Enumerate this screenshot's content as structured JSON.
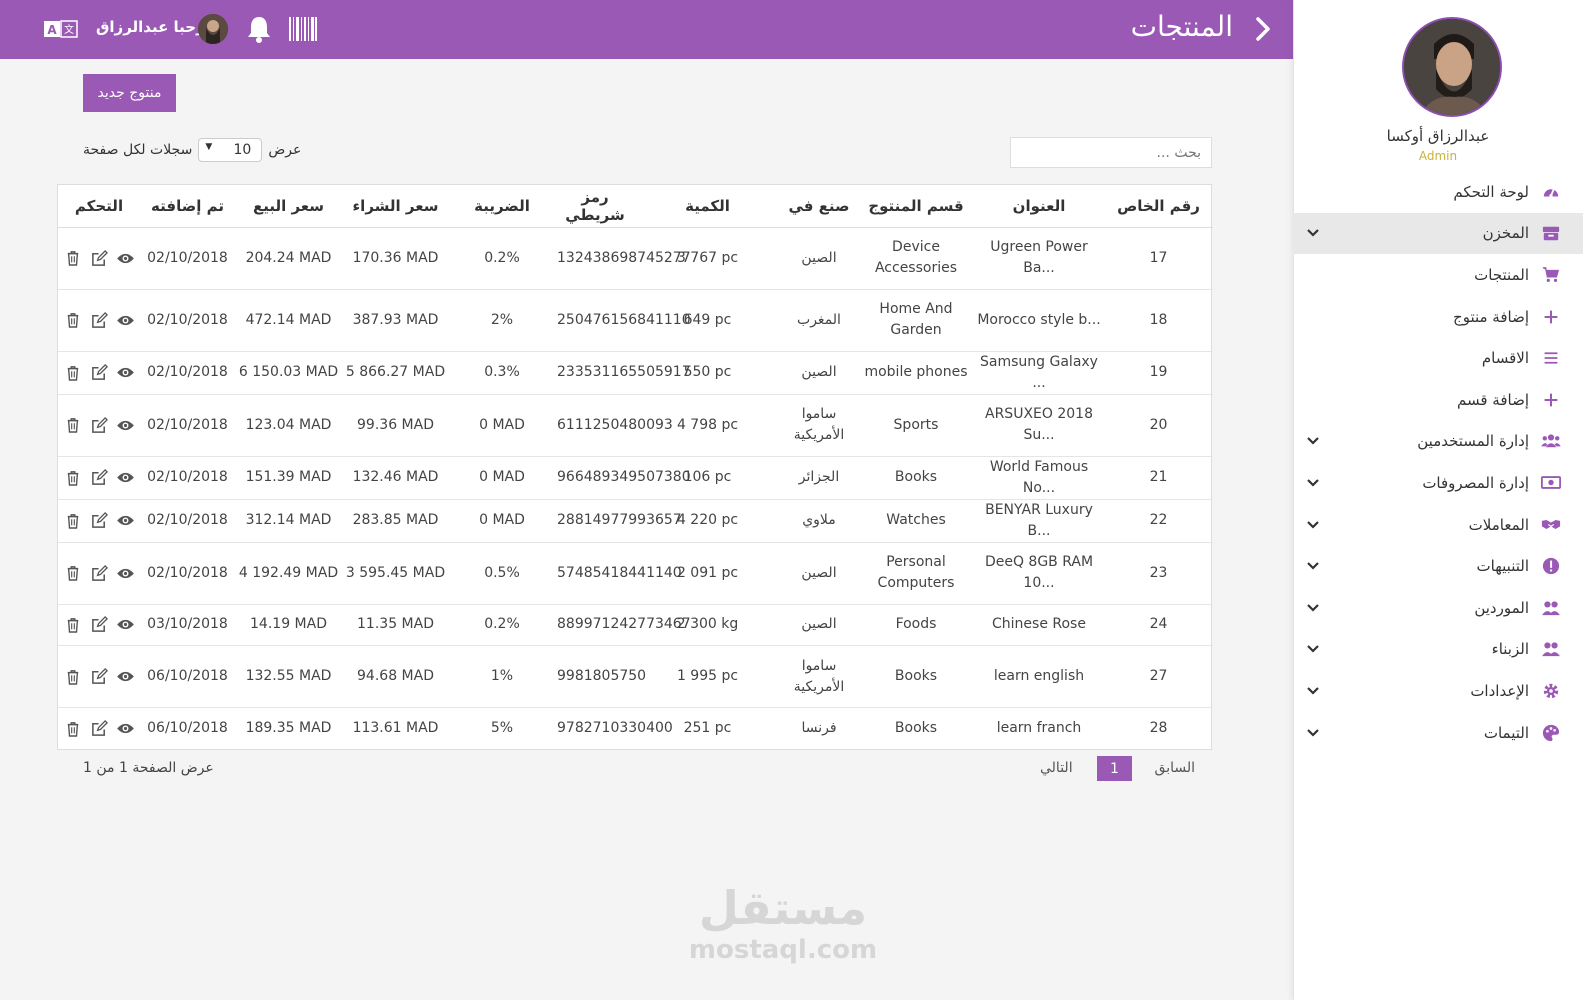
{
  "header": {
    "title": "المنتجات",
    "greeting": "مرحبا عبدالرزاق",
    "lang_label": "A文"
  },
  "sidebar": {
    "user_name": "عبدالرزاق أوكسا",
    "user_role": "Admin",
    "items": [
      {
        "label": "لوحة التحكم",
        "icon": "dashboard-icon"
      },
      {
        "label": "المخزن",
        "icon": "warehouse-icon"
      },
      {
        "label": "المنتجات",
        "icon": "cart-icon"
      },
      {
        "label": "إضافة منتوج",
        "icon": "plus-icon"
      },
      {
        "label": "الاقسام",
        "icon": "list-icon"
      },
      {
        "label": "إضافة قسم",
        "icon": "plus-icon"
      },
      {
        "label": "إدارة المستخدمين",
        "icon": "users-icon"
      },
      {
        "label": "إدارة المصروفات",
        "icon": "money-icon"
      },
      {
        "label": "المعاملات",
        "icon": "handshake-icon"
      },
      {
        "label": "التنبيهات",
        "icon": "alert-icon"
      },
      {
        "label": "الموردين",
        "icon": "suppliers-icon"
      },
      {
        "label": "الزبناء",
        "icon": "customers-icon"
      },
      {
        "label": "الإعدادات",
        "icon": "gear-icon"
      },
      {
        "label": "التيمات",
        "icon": "palette-icon"
      }
    ]
  },
  "toolbar": {
    "new_button": "منتوج جديد",
    "show_label": "عرض",
    "page_length": "10",
    "per_page_label": "سجلات لكل صفحة",
    "search_placeholder": "بحث ..."
  },
  "table": {
    "columns": [
      "رقم الخاص",
      "العنوان",
      "قسم المنتوج",
      "صنع في",
      "الكمية",
      "رمز شريطي",
      "الضريبة",
      "سعر الشراء",
      "سعر البيع",
      "تم إضافته",
      "التحكم"
    ],
    "rows": [
      {
        "id": "17",
        "title": "Ugreen Power Ba...",
        "category": "Device Accessories",
        "made_in": "الصين",
        "qty": "3 767 pc",
        "barcode": "132438698745277",
        "tax": "0.2%",
        "buy": "170.36 MAD",
        "sell": "204.24 MAD",
        "date": "02/10/2018"
      },
      {
        "id": "18",
        "title": "Morocco style b...",
        "category": "Home And Garden",
        "made_in": "المغرب",
        "qty": "649 pc",
        "barcode": "250476156841110",
        "tax": "2%",
        "buy": "387.93 MAD",
        "sell": "472.14 MAD",
        "date": "02/10/2018"
      },
      {
        "id": "19",
        "title": "Samsung Galaxy ...",
        "category": "mobile phones",
        "made_in": "الصين",
        "qty": "550 pc",
        "barcode": "233531165505917",
        "tax": "0.3%",
        "buy": "5 866.27 MAD",
        "sell": "6 150.03 MAD",
        "date": "02/10/2018"
      },
      {
        "id": "20",
        "title": "ARSUXEO 2018 Su...",
        "category": "Sports",
        "made_in": "ساموا الأمريكية",
        "qty": "4 798 pc",
        "barcode": "6111250480093",
        "tax": "0 MAD",
        "buy": "99.36 MAD",
        "sell": "123.04 MAD",
        "date": "02/10/2018"
      },
      {
        "id": "21",
        "title": "World Famous No...",
        "category": "Books",
        "made_in": "الجزائر",
        "qty": "106 pc",
        "barcode": "966489349507380",
        "tax": "0 MAD",
        "buy": "132.46 MAD",
        "sell": "151.39 MAD",
        "date": "02/10/2018"
      },
      {
        "id": "22",
        "title": "BENYAR Luxury B...",
        "category": "Watches",
        "made_in": "ملاوي",
        "qty": "4 220 pc",
        "barcode": "28814977993657",
        "tax": "0 MAD",
        "buy": "283.85 MAD",
        "sell": "312.14 MAD",
        "date": "02/10/2018"
      },
      {
        "id": "23",
        "title": "DeeQ 8GB RAM 10...",
        "category": "Personal Computers",
        "made_in": "الصين",
        "qty": "2 091 pc",
        "barcode": "57485418441140",
        "tax": "0.5%",
        "buy": "3 595.45 MAD",
        "sell": "4 192.49 MAD",
        "date": "02/10/2018"
      },
      {
        "id": "24",
        "title": "Chinese Rose",
        "category": "Foods",
        "made_in": "الصين",
        "qty": "2 300 kg",
        "barcode": "889971242773467",
        "tax": "0.2%",
        "buy": "11.35 MAD",
        "sell": "14.19 MAD",
        "date": "03/10/2018"
      },
      {
        "id": "27",
        "title": "learn english",
        "category": "Books",
        "made_in": "ساموا الأمريكية",
        "qty": "1 995 pc",
        "barcode": "9981805750",
        "tax": "1%",
        "buy": "94.68 MAD",
        "sell": "132.55 MAD",
        "date": "06/10/2018"
      },
      {
        "id": "28",
        "title": "learn franch",
        "category": "Books",
        "made_in": "فرنسا",
        "qty": "251 pc",
        "barcode": "9782710330400",
        "tax": "5%",
        "buy": "113.61 MAD",
        "sell": "189.35 MAD",
        "date": "06/10/2018"
      }
    ]
  },
  "pagination": {
    "prev": "السابق",
    "current": "1",
    "next": "التالي",
    "info": "عرض الصفحة 1 من 1"
  },
  "watermark": {
    "arabic": "مستقل",
    "latin": "mostaql.com"
  },
  "colors": {
    "accent": "#9b59b6",
    "role": "#c9b23a"
  }
}
